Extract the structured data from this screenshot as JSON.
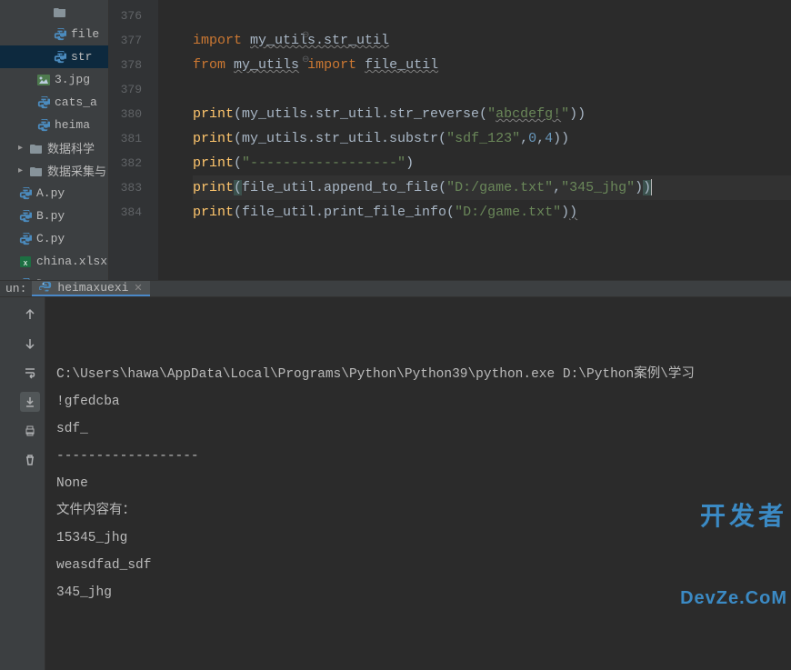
{
  "editor": {
    "line_start": 376,
    "lines": [
      {
        "n": 376,
        "tokens": []
      },
      {
        "n": 377,
        "tokens": [
          {
            "t": "import",
            "c": "kw"
          },
          {
            "t": " "
          },
          {
            "t": "my_utils.str_util",
            "c": "id underline"
          }
        ]
      },
      {
        "n": 378,
        "tokens": [
          {
            "t": "from",
            "c": "kw"
          },
          {
            "t": " "
          },
          {
            "t": "my_utils",
            "c": "id underline"
          },
          {
            "t": " "
          },
          {
            "t": "import",
            "c": "kw"
          },
          {
            "t": " "
          },
          {
            "t": "file_util",
            "c": "id underline"
          }
        ]
      },
      {
        "n": 379,
        "tokens": []
      },
      {
        "n": 380,
        "tokens": [
          {
            "t": "print",
            "c": "fn"
          },
          {
            "t": "(my_utils.str_util.str_reverse("
          },
          {
            "t": "\"",
            "c": "str"
          },
          {
            "t": "abcdefg!",
            "c": "str underline"
          },
          {
            "t": "\"",
            "c": "str"
          },
          {
            "t": "))"
          }
        ]
      },
      {
        "n": 381,
        "tokens": [
          {
            "t": "print",
            "c": "fn"
          },
          {
            "t": "(my_utils.str_util.substr("
          },
          {
            "t": "\"sdf_123\"",
            "c": "str"
          },
          {
            "t": ","
          },
          {
            "t": "0",
            "c": "num"
          },
          {
            "t": ","
          },
          {
            "t": "4",
            "c": "num"
          },
          {
            "t": "))"
          }
        ]
      },
      {
        "n": 382,
        "tokens": [
          {
            "t": "print",
            "c": "fn"
          },
          {
            "t": "("
          },
          {
            "t": "\"------------------\"",
            "c": "str"
          },
          {
            "t": ")"
          }
        ]
      },
      {
        "n": 383,
        "active": true,
        "tokens": [
          {
            "t": "print",
            "c": "fn"
          },
          {
            "t": "(",
            "c": "paren-hl"
          },
          {
            "t": "file_util.append_to_file("
          },
          {
            "t": "\"D:/game.txt\"",
            "c": "str"
          },
          {
            "t": ","
          },
          {
            "t": "\"345_jhg\"",
            "c": "str"
          },
          {
            "t": ")"
          },
          {
            "t": ")",
            "c": "paren-hl"
          },
          {
            "t": "",
            "caret": true
          }
        ]
      },
      {
        "n": 384,
        "tokens": [
          {
            "t": "print",
            "c": "fn"
          },
          {
            "t": "(file_util.print_file_info("
          },
          {
            "t": "\"D:/game.txt\"",
            "c": "str"
          },
          {
            "t": ")"
          },
          {
            "t": ")",
            "c": "underline"
          }
        ]
      }
    ]
  },
  "sidebar": {
    "items": [
      {
        "label": "",
        "icon": "folder",
        "indent": 3
      },
      {
        "label": "file",
        "icon": "py",
        "indent": 3
      },
      {
        "label": "str",
        "icon": "py",
        "indent": 3,
        "selected": true
      },
      {
        "label": "3.jpg",
        "icon": "img",
        "indent": 2
      },
      {
        "label": "cats_a",
        "icon": "py",
        "indent": 2
      },
      {
        "label": "heima",
        "icon": "py",
        "indent": 2
      },
      {
        "label": "数据科学",
        "icon": "folder",
        "indent": 1,
        "chevron": true
      },
      {
        "label": "数据采集与",
        "icon": "folder",
        "indent": 1,
        "chevron": true
      },
      {
        "label": "A.py",
        "icon": "py",
        "indent": 1
      },
      {
        "label": "B.py",
        "icon": "py",
        "indent": 1
      },
      {
        "label": "C.py",
        "icon": "py",
        "indent": 1
      },
      {
        "label": "china.xlsx",
        "icon": "xls",
        "indent": 1
      },
      {
        "label": "D.py",
        "icon": "py",
        "indent": 1
      }
    ]
  },
  "run": {
    "prefix": "un:",
    "tab_label": "heimaxuexi"
  },
  "console": {
    "lines": [
      "C:\\Users\\hawa\\AppData\\Local\\Programs\\Python\\Python39\\python.exe D:\\Python案例\\学习",
      "!gfedcba",
      "sdf_",
      "------------------",
      "None",
      "文件内容有：",
      "15345_jhg",
      "weasdfad_sdf",
      "345_jhg"
    ]
  },
  "watermark": {
    "line1": "开发者",
    "line2": "DevZe.CoM"
  }
}
